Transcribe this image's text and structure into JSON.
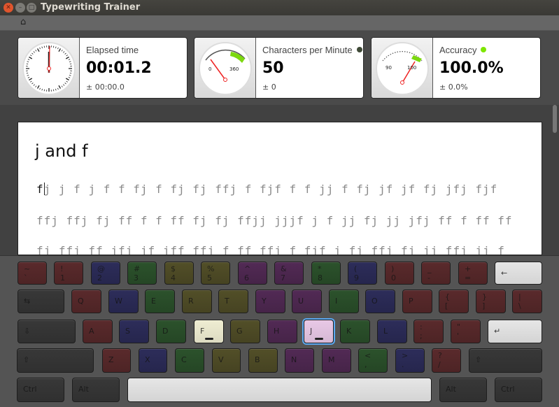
{
  "window": {
    "title": "Typewriting Trainer"
  },
  "toolbar": {
    "home_icon": "home-icon"
  },
  "stats": [
    {
      "label": "Elapsed time",
      "value": "00:01.2",
      "deviation": "± 00:00.0",
      "gauge": "clock",
      "dot_color": null
    },
    {
      "label": "Characters per Minute",
      "value": "50",
      "deviation": "± 0",
      "gauge": "speedometer",
      "scale_labels": [
        "0",
        "360"
      ],
      "dot_color": "#3f4a37"
    },
    {
      "label": "Accuracy",
      "value": "100.0%",
      "deviation": "± 0.0%",
      "gauge": "accuracy-meter",
      "scale_labels": [
        "90",
        "100"
      ],
      "dot_color": "#7ee600"
    }
  ],
  "lesson": {
    "title": "j and f",
    "typed": "f",
    "lines": [
      "j j f j f f fj f fj fj ffj f fjf f f jj f fj jf jf fj jfj fjf",
      "ffj ffj fj ff f f ff fj fj ffjj jjjf j f jj fj jj jfj ff f ff ff",
      "fj ffj ff jfj jf jff ffj f ff ffj f fjf j fj ffj fj jj ffj jj f"
    ]
  },
  "colors": {
    "red": "#5a2a2c",
    "blue": "#2d2d5a",
    "green": "#2c522c",
    "olive": "#524f28",
    "purple": "#522a55",
    "gray": "#383838",
    "light": "#e6e6e6",
    "f_active": "#efedd2",
    "j_active": "#e8c8e6"
  },
  "keyboard": {
    "rows": [
      [
        {
          "t": "~",
          "b": "`",
          "c": "red"
        },
        {
          "t": "!",
          "b": "1",
          "c": "red"
        },
        {
          "t": "@",
          "b": "2",
          "c": "blue"
        },
        {
          "t": "#",
          "b": "3",
          "c": "green"
        },
        {
          "t": "$",
          "b": "4",
          "c": "olive"
        },
        {
          "t": "%",
          "b": "5",
          "c": "olive"
        },
        {
          "t": "^",
          "b": "6",
          "c": "purple"
        },
        {
          "t": "&",
          "b": "7",
          "c": "purple"
        },
        {
          "t": "*",
          "b": "8",
          "c": "green"
        },
        {
          "t": "(",
          "b": "9",
          "c": "blue"
        },
        {
          "t": ")",
          "b": "0",
          "c": "red"
        },
        {
          "t": "_",
          "b": "-",
          "c": "red"
        },
        {
          "t": "+",
          "b": "=",
          "c": "red"
        },
        {
          "m": "←",
          "c": "light",
          "name": "backspace"
        }
      ],
      [
        {
          "m": "⇆",
          "c": "gray",
          "name": "tab"
        },
        {
          "m": "Q",
          "c": "red"
        },
        {
          "m": "W",
          "c": "blue"
        },
        {
          "m": "E",
          "c": "green"
        },
        {
          "m": "R",
          "c": "olive"
        },
        {
          "m": "T",
          "c": "olive"
        },
        {
          "m": "Y",
          "c": "purple"
        },
        {
          "m": "U",
          "c": "purple"
        },
        {
          "m": "I",
          "c": "green"
        },
        {
          "m": "O",
          "c": "blue"
        },
        {
          "m": "P",
          "c": "red"
        },
        {
          "t": "{",
          "b": "[",
          "c": "red"
        },
        {
          "t": "}",
          "b": "]",
          "c": "red"
        },
        {
          "t": "|",
          "b": "\\",
          "c": "red"
        }
      ],
      [
        {
          "m": "⇩",
          "c": "gray",
          "name": "caps-lock"
        },
        {
          "m": "A",
          "c": "red"
        },
        {
          "m": "S",
          "c": "blue"
        },
        {
          "m": "D",
          "c": "green"
        },
        {
          "m": "F",
          "c": "f_active",
          "bump": true
        },
        {
          "m": "G",
          "c": "olive"
        },
        {
          "m": "H",
          "c": "purple"
        },
        {
          "m": "J",
          "c": "j_active",
          "bump": true,
          "highlight": true
        },
        {
          "m": "K",
          "c": "green"
        },
        {
          "m": "L",
          "c": "blue"
        },
        {
          "t": ":",
          "b": ";",
          "c": "red"
        },
        {
          "t": "\"",
          "b": "'",
          "c": "red"
        },
        {
          "m": "↵",
          "c": "light",
          "name": "enter"
        }
      ],
      [
        {
          "m": "⇧",
          "c": "gray",
          "name": "left-shift"
        },
        {
          "m": "Z",
          "c": "red"
        },
        {
          "m": "X",
          "c": "blue"
        },
        {
          "m": "C",
          "c": "green"
        },
        {
          "m": "V",
          "c": "olive"
        },
        {
          "m": "B",
          "c": "olive"
        },
        {
          "m": "N",
          "c": "purple"
        },
        {
          "m": "M",
          "c": "purple"
        },
        {
          "t": "<",
          "b": ",",
          "c": "green"
        },
        {
          "t": ">",
          "b": ".",
          "c": "blue"
        },
        {
          "t": "?",
          "b": "/",
          "c": "red"
        },
        {
          "m": "⇧",
          "c": "gray",
          "name": "right-shift"
        }
      ],
      [
        {
          "m": "Ctrl",
          "c": "gray",
          "name": "left-ctrl"
        },
        {
          "m": "Alt",
          "c": "gray",
          "name": "left-alt"
        },
        {
          "m": "",
          "c": "light",
          "name": "space"
        },
        {
          "m": "Alt",
          "c": "gray",
          "name": "right-alt"
        },
        {
          "m": "Ctrl",
          "c": "gray",
          "name": "right-ctrl"
        }
      ]
    ]
  }
}
